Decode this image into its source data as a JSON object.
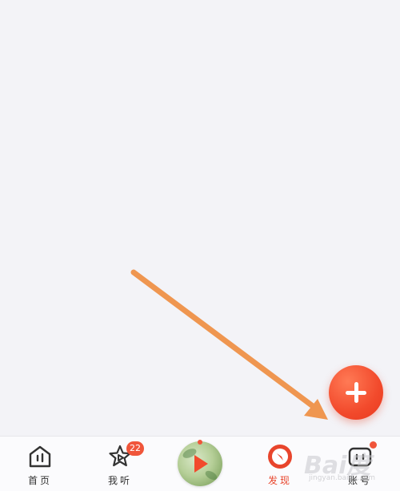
{
  "fab": {
    "icon": "plus-icon",
    "color": "#f24a2c"
  },
  "annotation": {
    "arrow_color": "#ef9650"
  },
  "tabbar": {
    "tabs": [
      {
        "label": "首页",
        "icon": "home-house-icon",
        "active": false
      },
      {
        "label": "我听",
        "icon": "star-play-icon",
        "active": false,
        "badge": "22"
      },
      {
        "label": "",
        "icon": "album-play-icon",
        "active": false
      },
      {
        "label": "发现",
        "icon": "discover-compass-icon",
        "active": true
      },
      {
        "label": "账号",
        "icon": "account-robot-icon",
        "active": false,
        "dot": true
      }
    ],
    "accent_color": "#e8452c"
  },
  "watermark": {
    "main": "Bai度",
    "sub": "jingyan.baidu.com"
  }
}
